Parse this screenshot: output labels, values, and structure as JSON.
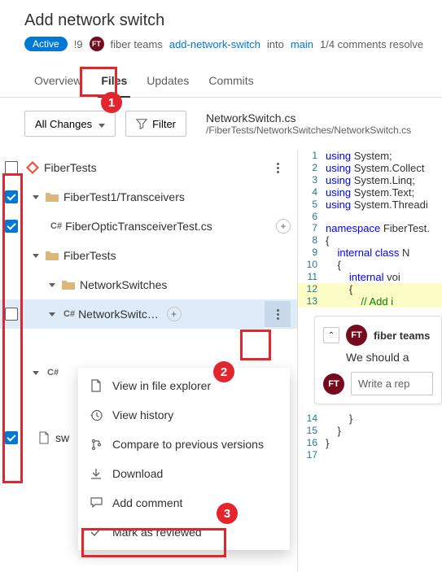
{
  "header": {
    "title": "Add network switch",
    "badge": "Active",
    "pr_number": "!9",
    "avatar_initials": "FT",
    "team": "fiber teams",
    "source_branch": "add-network-switch",
    "into": "into",
    "target_branch": "main",
    "comments_status": "1/4 comments resolve"
  },
  "tabs": {
    "overview": "Overview",
    "files": "Files",
    "updates": "Updates",
    "commits": "Commits"
  },
  "toolbar": {
    "all_changes": "All Changes",
    "filter": "Filter",
    "file_name": "NetworkSwitch.cs",
    "file_path": "/FiberTests/NetworkSwitches/NetworkSwitch.cs"
  },
  "tree": {
    "root": "FiberTests",
    "folder1": "FiberTest1/Transceivers",
    "file1": "FiberOpticTransceiverTest.cs",
    "folder2": "FiberTests",
    "folder3": "NetworkSwitches",
    "file2": "NetworkSwitch.cs",
    "file3_prefix": "C#",
    "file4": "sw",
    "cs": "C#",
    "add_badge": "+"
  },
  "menu": {
    "view_explorer": "View in file explorer",
    "view_history": "View history",
    "compare": "Compare to previous versions",
    "download": "Download",
    "add_comment": "Add comment",
    "mark_reviewed": "Mark as reviewed"
  },
  "code": {
    "lines": [
      {
        "n": 1,
        "t": "using",
        "r": " System;"
      },
      {
        "n": 2,
        "t": "using",
        "r": " System.Collect"
      },
      {
        "n": 3,
        "t": "using",
        "r": " System.Linq;"
      },
      {
        "n": 4,
        "t": "using",
        "r": " System.Text;"
      },
      {
        "n": 5,
        "t": "using",
        "r": " System.Threadi"
      },
      {
        "n": 6,
        "t": "",
        "r": ""
      },
      {
        "n": 7,
        "t": "namespace",
        "r": " FiberTest."
      },
      {
        "n": 8,
        "t": "",
        "r": "{"
      },
      {
        "n": 9,
        "t": "    internal",
        "r": " class N",
        "cls": true
      },
      {
        "n": 10,
        "t": "",
        "r": "    {"
      },
      {
        "n": 11,
        "t": "        internal",
        "r": " voi"
      },
      {
        "n": 12,
        "t": "",
        "r": "        {",
        "hl": true
      },
      {
        "n": 13,
        "t": "",
        "r": "            ",
        "cmt": "// Add i",
        "hl": true
      }
    ],
    "lines_tail": [
      {
        "n": 14,
        "r": "        }"
      },
      {
        "n": 15,
        "r": "    }"
      },
      {
        "n": 16,
        "r": "}"
      },
      {
        "n": 17,
        "r": ""
      }
    ]
  },
  "comment": {
    "author": "fiber teams",
    "body": "We should a",
    "reply_placeholder": "Write a rep",
    "avatar": "FT"
  }
}
